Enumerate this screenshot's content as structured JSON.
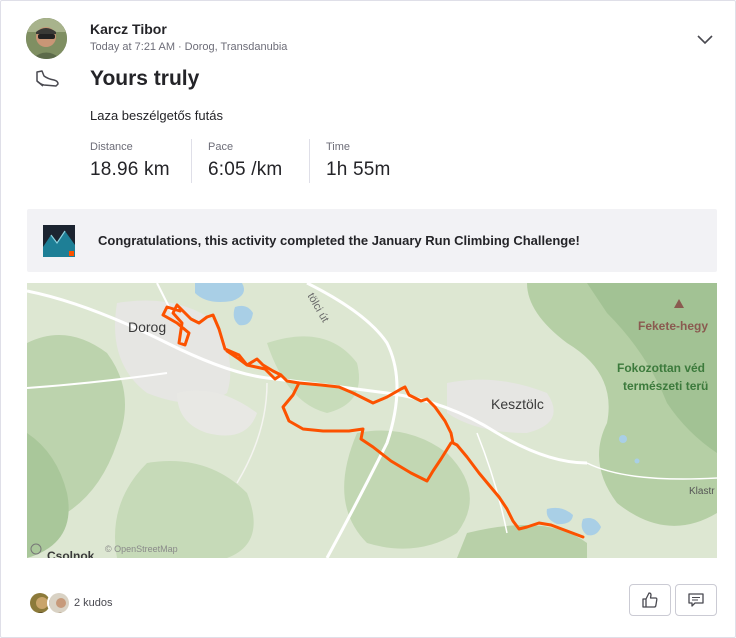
{
  "athlete": {
    "name": "Karcz Tibor",
    "time": "Today at 7:21 AM",
    "separator": "·",
    "location": "Dorog, Transdanubia"
  },
  "activity": {
    "title": "Yours truly",
    "description": "Laza beszélgetős futás",
    "sport_icon": "shoe-icon"
  },
  "stats": [
    {
      "label": "Distance",
      "value": "18.96 km"
    },
    {
      "label": "Pace",
      "value": "6:05 /km"
    },
    {
      "label": "Time",
      "value": "1h 55m"
    }
  ],
  "challenge": {
    "text": "Congratulations, this activity completed the January Run Climbing Challenge!"
  },
  "map": {
    "labels": {
      "dorog": "Dorog",
      "kesztolc": "Kesztölc",
      "road": "tölci út",
      "fekete": "Fekete-hegy",
      "fok1": "Fokozottan véd",
      "fok2": "természeti terü",
      "klastr": "Klastr",
      "attribution": "© OpenStreetMap",
      "bottom": "Csolnok"
    },
    "route_color": "#fc5200"
  },
  "kudos": {
    "text": "2 kudos"
  },
  "colors": {
    "accent": "#fc5200",
    "text": "#242428",
    "muted": "#6d6d78"
  }
}
